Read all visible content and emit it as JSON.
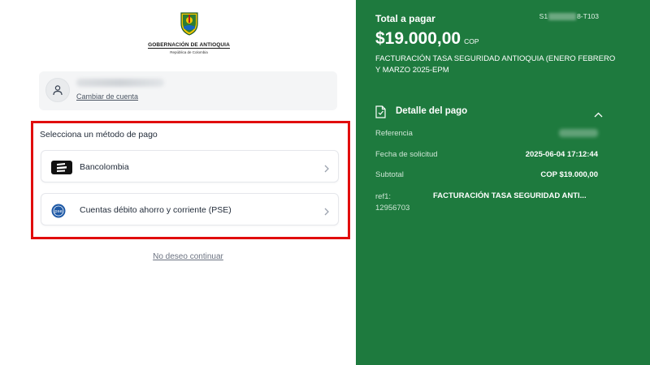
{
  "brand": {
    "logo_title": "GOBERNACIÓN DE ANTIOQUIA",
    "logo_subtitle": "República de Colombia"
  },
  "account": {
    "avatar_icon": "user-icon",
    "change_account": "Cambiar de cuenta"
  },
  "payment_methods": {
    "title": "Selecciona un método de pago",
    "items": [
      {
        "label": "Bancolombia",
        "icon": "bancolombia-logo-icon"
      },
      {
        "label": "Cuentas débito ahorro y corriente (PSE)",
        "icon": "pse-logo-icon"
      }
    ]
  },
  "no_continue": "No deseo continuar",
  "summary": {
    "total_label": "Total a pagar",
    "reference_prefix": "S1",
    "reference_suffix": "8-T103",
    "amount": "$19.000,00",
    "currency": "COP",
    "description": "FACTURACIÓN TASA SEGURIDAD ANTIOQUIA (ENERO FEBRERO Y MARZO 2025-EPM"
  },
  "detail": {
    "title": "Detalle del pago",
    "icon": "document-icon",
    "rows": [
      {
        "label": "Referencia",
        "value": ""
      },
      {
        "label": "Fecha de solicitud",
        "value": "2025-06-04 17:12:44"
      },
      {
        "label": "Subtotal",
        "value": "COP $19.000,00"
      },
      {
        "label_line1": "ref1:",
        "label_line2": "12956703",
        "value": "FACTURACIÓN TASA SEGURIDAD ANTI..."
      }
    ]
  },
  "colors": {
    "right_panel": "#1e7a3e",
    "highlight_border": "#e10d0d"
  }
}
